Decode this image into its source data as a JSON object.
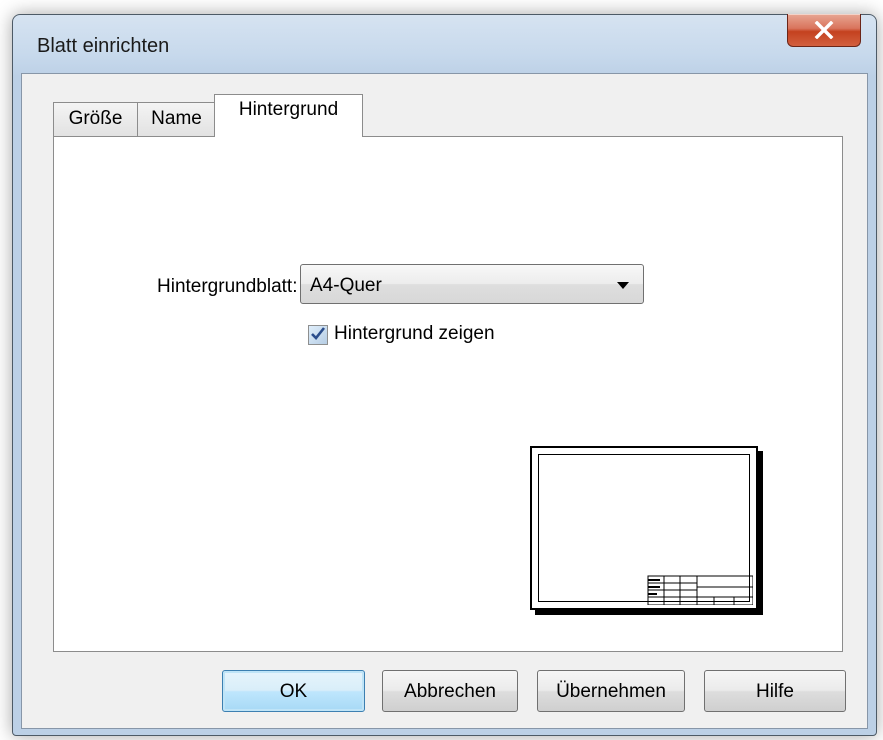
{
  "window": {
    "title": "Blatt einrichten"
  },
  "tabs": [
    {
      "label": "Größe",
      "active": false
    },
    {
      "label": "Name",
      "active": false
    },
    {
      "label": "Hintergrund",
      "active": true
    }
  ],
  "background": {
    "sheet_label": "Hintergrundblatt:",
    "sheet_value": "A4-Quer",
    "show_background_label": "Hintergrund zeigen",
    "show_background_checked": true
  },
  "buttons": {
    "ok": "OK",
    "cancel": "Abbrechen",
    "apply": "Übernehmen",
    "help": "Hilfe"
  },
  "colors": {
    "close_button": "#c4411f",
    "default_button_border": "#3c7fb1",
    "checkbox_check": "#2a4d8c"
  },
  "icons": {
    "close": "close-icon",
    "dropdown": "chevron-down-icon",
    "check": "checkmark-icon"
  }
}
